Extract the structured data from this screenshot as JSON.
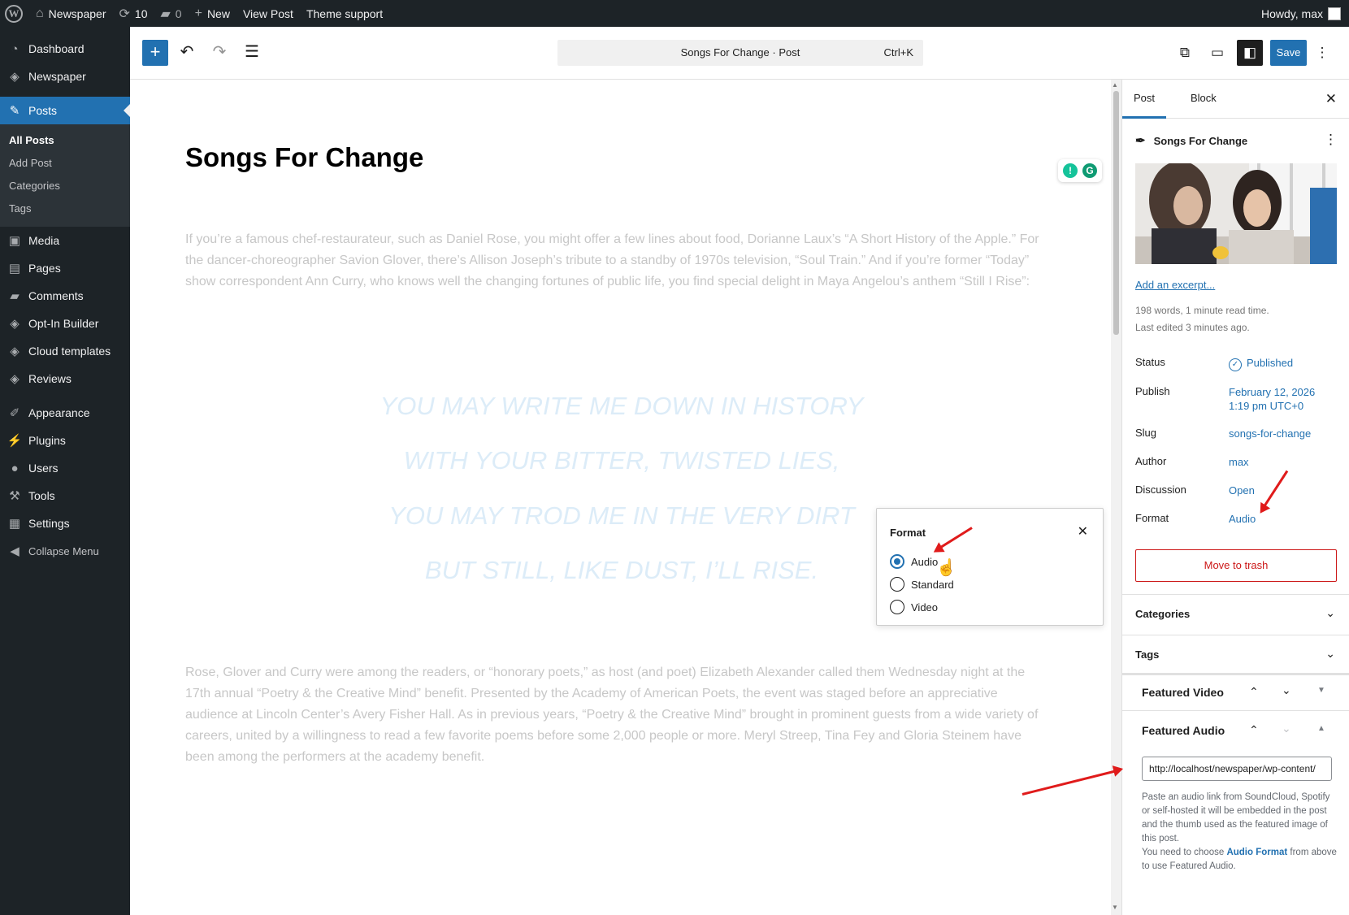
{
  "adminbar": {
    "site_name": "Newspaper",
    "updates_count": "10",
    "comments_count": "0",
    "new_label": "New",
    "view_post": "View Post",
    "theme_support": "Theme support",
    "howdy": "Howdy, max"
  },
  "sidebar": {
    "items": [
      {
        "label": "Dashboard",
        "icon": "dashboard-icon"
      },
      {
        "label": "Newspaper",
        "icon": "newspaper-icon"
      },
      {
        "label": "Posts",
        "icon": "pin-icon"
      },
      {
        "label": "Media",
        "icon": "media-icon"
      },
      {
        "label": "Pages",
        "icon": "pages-icon"
      },
      {
        "label": "Comments",
        "icon": "comments-icon"
      },
      {
        "label": "Opt-In Builder",
        "icon": "optin-icon"
      },
      {
        "label": "Cloud templates",
        "icon": "cloud-icon"
      },
      {
        "label": "Reviews",
        "icon": "reviews-icon"
      },
      {
        "label": "Appearance",
        "icon": "brush-icon"
      },
      {
        "label": "Plugins",
        "icon": "plugin-icon"
      },
      {
        "label": "Users",
        "icon": "user-icon"
      },
      {
        "label": "Tools",
        "icon": "wrench-icon"
      },
      {
        "label": "Settings",
        "icon": "settings-icon"
      },
      {
        "label": "Collapse Menu",
        "icon": "collapse-icon"
      }
    ],
    "posts_submenu": [
      "All Posts",
      "Add Post",
      "Categories",
      "Tags"
    ]
  },
  "toolbar": {
    "command_text": "Songs For Change · Post",
    "shortcut": "Ctrl+K",
    "save_label": "Save"
  },
  "editor": {
    "title": "Songs For Change",
    "paragraph1": "If you’re a famous chef-restaurateur, such as Daniel Rose, you might offer a few lines about food, Dorianne Laux’s “A Short History of the Apple.” For the dancer-choreographer Savion Glover, there’s Allison Joseph’s tribute to a standby of 1970s television, “Soul Train.” And if you’re former “Today” show correspondent Ann Curry, who knows well the changing fortunes of public life, you find special delight in Maya Angelou’s anthem “Still I Rise”:",
    "poem": [
      "YOU MAY WRITE ME DOWN IN HISTORY",
      "WITH YOUR BITTER, TWISTED LIES,",
      "YOU MAY TROD ME IN THE VERY DIRT",
      "BUT STILL, LIKE DUST, I’LL RISE."
    ],
    "paragraph2": "Rose, Glover and Curry were among the readers, or “honorary poets,” as host (and poet) Elizabeth Alexander called them Wednesday night at the 17th annual “Poetry & the Creative Mind” benefit. Presented by the Academy of American Poets, the event was staged before an appreciative audience at Lincoln Center’s Avery Fisher Hall. As in previous years, “Poetry & the Creative Mind” brought in prominent guests from a wide variety of careers, united by a willingness to read a few favorite poems before some 2,000 people or more. Meryl Streep, Tina Fey and Gloria Steinem have been among the performers at the academy benefit."
  },
  "format_popover": {
    "title": "Format",
    "options": [
      "Audio",
      "Standard",
      "Video"
    ],
    "selected": "Audio"
  },
  "settings": {
    "tabs": [
      "Post",
      "Block"
    ],
    "post_title": "Songs For Change",
    "add_excerpt": "Add an excerpt...",
    "word_count": "198 words, 1 minute read time.",
    "last_edited": "Last edited 3 minutes ago.",
    "rows": {
      "status": {
        "label": "Status",
        "value": "Published"
      },
      "publish": {
        "label": "Publish",
        "value_line1": "February 12, 2026",
        "value_line2": "1:19 pm UTC+0"
      },
      "slug": {
        "label": "Slug",
        "value": "songs-for-change"
      },
      "author": {
        "label": "Author",
        "value": "max"
      },
      "discussion": {
        "label": "Discussion",
        "value": "Open"
      },
      "format": {
        "label": "Format",
        "value": "Audio"
      }
    },
    "trash_label": "Move to trash",
    "categories": "Categories",
    "tags": "Tags",
    "featured_video": "Featured Video",
    "featured_audio": "Featured Audio",
    "audio_url": "http://localhost/newspaper/wp-content/",
    "help_text": "Paste an audio link from SoundCloud, Spotify or self-hosted it will be embedded in the post and the thumb used as the featured image of this post.",
    "help_text2_pre": "You need to choose ",
    "help_text2_link": "Audio Format",
    "help_text2_post": " from above to use Featured Audio."
  },
  "colors": {
    "accent": "#2271b1",
    "admin_dark": "#1d2327",
    "danger": "#cc1818",
    "annotation_arrow": "#e01b1b"
  }
}
